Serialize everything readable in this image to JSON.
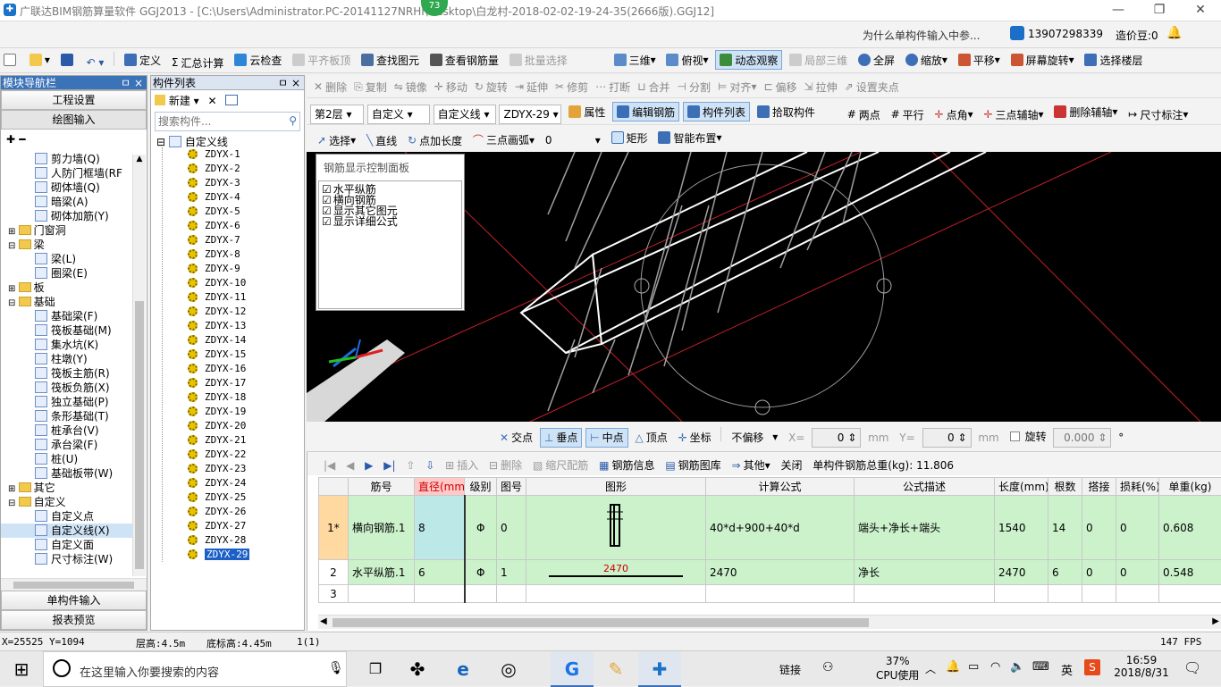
{
  "window": {
    "title": "广联达BIM钢筋算量软件 GGJ2013 - [C:\\Users\\Administrator.PC-20141127NRHI\\Desktop\\白龙村-2018-02-02-19-24-35(2666版).GGJ12]",
    "badge": "73",
    "min": "—",
    "restore": "❐",
    "close": "✕"
  },
  "menubar": {
    "help_link": "为什么单构件输入中参...",
    "phone": "13907298339",
    "price": "造价豆:0"
  },
  "toolbar1": {
    "items": [
      "定义",
      "汇总计算",
      "云检查",
      "平齐板顶",
      "查找图元",
      "查看钢筋量",
      "批量选择"
    ],
    "view": [
      "三维",
      "俯视",
      "动态观察",
      "局部三维",
      "全屏",
      "缩放",
      "平移",
      "屏幕旋转",
      "选择楼层"
    ]
  },
  "toolbar2": {
    "items": [
      "删除",
      "复制",
      "镜像",
      "移动",
      "旋转",
      "延伸",
      "修剪",
      "打断",
      "合并",
      "分割",
      "对齐",
      "偏移",
      "拉伸",
      "设置夹点"
    ]
  },
  "toolbar3": {
    "floor": "第2层",
    "type": "自定义",
    "subtype": "自定义线",
    "component": "ZDYX-29",
    "items": [
      "属性",
      "编辑钢筋",
      "构件列表",
      "拾取构件"
    ],
    "right": [
      "两点",
      "平行",
      "点角",
      "三点辅轴",
      "删除辅轴",
      "尺寸标注"
    ]
  },
  "toolbar4": {
    "items": [
      "选择",
      "直线",
      "点加长度",
      "三点画弧"
    ],
    "arc_value": "0",
    "rect": "矩形",
    "smart": "智能布置"
  },
  "nav": {
    "title": "模块导航栏",
    "pin": "ㅁ",
    "close": "×",
    "btn_settings": "工程设置",
    "btn_drawing": "绘图输入",
    "btn_single": "单构件输入",
    "btn_report": "报表预览",
    "tree": [
      {
        "label": "剪力墙(Q)",
        "level": 2
      },
      {
        "label": "人防门框墙(RF",
        "level": 2
      },
      {
        "label": "砌体墙(Q)",
        "level": 2
      },
      {
        "label": "暗梁(A)",
        "level": 2
      },
      {
        "label": "砌体加筋(Y)",
        "level": 2
      },
      {
        "label": "门窗洞",
        "level": 1,
        "folder": true,
        "open": false
      },
      {
        "label": "梁",
        "level": 1,
        "folder": true,
        "open": true
      },
      {
        "label": "梁(L)",
        "level": 2
      },
      {
        "label": "圈梁(E)",
        "level": 2
      },
      {
        "label": "板",
        "level": 1,
        "folder": true,
        "open": false
      },
      {
        "label": "基础",
        "level": 1,
        "folder": true,
        "open": true
      },
      {
        "label": "基础梁(F)",
        "level": 2
      },
      {
        "label": "筏板基础(M)",
        "level": 2
      },
      {
        "label": "集水坑(K)",
        "level": 2
      },
      {
        "label": "柱墩(Y)",
        "level": 2
      },
      {
        "label": "筏板主筋(R)",
        "level": 2
      },
      {
        "label": "筏板负筋(X)",
        "level": 2
      },
      {
        "label": "独立基础(P)",
        "level": 2
      },
      {
        "label": "条形基础(T)",
        "level": 2
      },
      {
        "label": "桩承台(V)",
        "level": 2
      },
      {
        "label": "承台梁(F)",
        "level": 2
      },
      {
        "label": "桩(U)",
        "level": 2
      },
      {
        "label": "基础板带(W)",
        "level": 2
      },
      {
        "label": "其它",
        "level": 1,
        "folder": true,
        "open": false
      },
      {
        "label": "自定义",
        "level": 1,
        "folder": true,
        "open": true
      },
      {
        "label": "自定义点",
        "level": 2
      },
      {
        "label": "自定义线(X)",
        "level": 2,
        "selected": true
      },
      {
        "label": "自定义面",
        "level": 2
      },
      {
        "label": "尺寸标注(W)",
        "level": 2
      }
    ]
  },
  "complist": {
    "title": "构件列表",
    "new": "新建",
    "search_placeholder": "搜索构件...",
    "root": "自定义线",
    "items": [
      "ZDYX-1",
      "ZDYX-2",
      "ZDYX-3",
      "ZDYX-4",
      "ZDYX-5",
      "ZDYX-6",
      "ZDYX-7",
      "ZDYX-8",
      "ZDYX-9",
      "ZDYX-10",
      "ZDYX-11",
      "ZDYX-12",
      "ZDYX-13",
      "ZDYX-14",
      "ZDYX-15",
      "ZDYX-16",
      "ZDYX-17",
      "ZDYX-18",
      "ZDYX-19",
      "ZDYX-20",
      "ZDYX-21",
      "ZDYX-22",
      "ZDYX-23",
      "ZDYX-24",
      "ZDYX-25",
      "ZDYX-26",
      "ZDYX-27",
      "ZDYX-28",
      "ZDYX-29"
    ],
    "selected": "ZDYX-29"
  },
  "rebar_panel": {
    "title": "钢筋显示控制面板",
    "options": [
      "水平纵筋",
      "横向钢筋",
      "显示其它图元",
      "显示详细公式"
    ]
  },
  "snapbar": {
    "items": [
      "交点",
      "垂点",
      "中点",
      "顶点",
      "坐标"
    ],
    "offset": "不偏移",
    "x_label": "X=",
    "x": "0",
    "mm": "mm",
    "y_label": "Y=",
    "y": "0",
    "rotate": "旋转",
    "rot_val": "0.000",
    "deg": "°"
  },
  "rebar_toolbar": {
    "items": [
      "插入",
      "删除",
      "缩尺配筋",
      "钢筋信息",
      "钢筋图库",
      "其他",
      "关闭"
    ],
    "total": "单构件钢筋总重(kg): 11.806"
  },
  "table": {
    "headers": [
      "",
      "筋号",
      "直径(mm)",
      "级别",
      "图号",
      "图形",
      "计算公式",
      "公式描述",
      "长度(mm)",
      "根数",
      "搭接",
      "损耗(%)",
      "单重(kg)"
    ],
    "rows": [
      {
        "no": "1*",
        "name": "横向钢筋.1",
        "dia": "8",
        "grade": "Φ",
        "fig": "0",
        "shape": "",
        "formula": "40*d+900+40*d",
        "desc": "端头+净长+端头",
        "len": "1540",
        "count": "14",
        "lap": "0",
        "loss": "0",
        "wt": "0.608"
      },
      {
        "no": "2",
        "name": "水平纵筋.1",
        "dia": "6",
        "grade": "Φ",
        "fig": "1",
        "shape": "2470",
        "formula": "2470",
        "desc": "净长",
        "len": "2470",
        "count": "6",
        "lap": "0",
        "loss": "0",
        "wt": "0.548"
      },
      {
        "no": "3",
        "name": "",
        "dia": "",
        "grade": "",
        "fig": "",
        "shape": "",
        "formula": "",
        "desc": "",
        "len": "",
        "count": "",
        "lap": "",
        "loss": "",
        "wt": ""
      }
    ]
  },
  "status": {
    "coords": "X=25525 Y=1094",
    "floor_h": "层高:4.5m",
    "base_h": "底标高:4.45m",
    "count": "1(1)",
    "fps": "147 FPS"
  },
  "taskbar": {
    "search_placeholder": "在这里输入你要搜索的内容",
    "link": "链接",
    "cpu": "37%",
    "cpu_label": "CPU使用",
    "ime": "英",
    "time": "16:59",
    "date": "2018/8/31"
  },
  "colors": {
    "accent": "#0b5fbf",
    "grid_green": "#ccf2cc",
    "cad_bg": "#000000"
  }
}
